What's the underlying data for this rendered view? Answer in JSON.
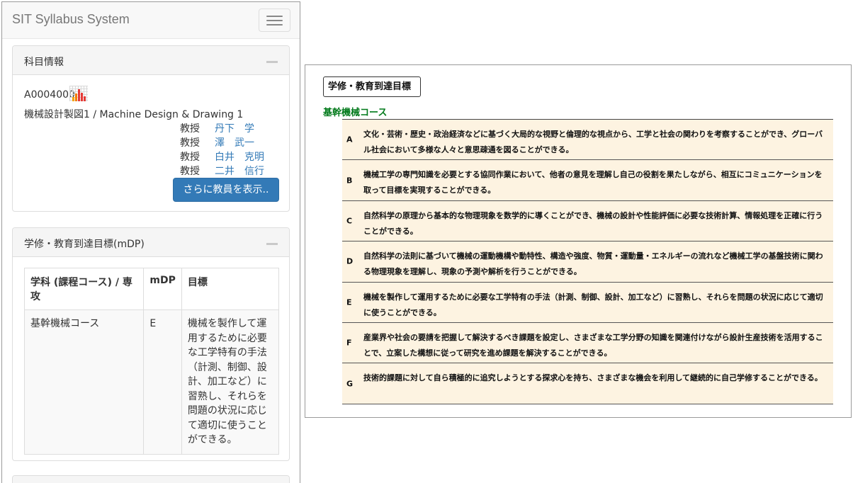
{
  "app": {
    "brand": "SIT Syllabus System"
  },
  "subject_panel": {
    "title": "科目情報",
    "code": "A0004000",
    "course_name": "機械設計製図1 / Machine Design & Drawing 1",
    "teachers": [
      {
        "role": "教授",
        "name": "丹下　学"
      },
      {
        "role": "教授",
        "name": "澤　武一"
      },
      {
        "role": "教授",
        "name": "白井　克明"
      },
      {
        "role": "教授",
        "name": "二井　信行"
      }
    ],
    "more_button": "さらに教員を表示.."
  },
  "dp_panel": {
    "title": "学修・教育到達目標(mDP)",
    "headers": [
      "学科 (課程コース) / 専攻",
      "mDP",
      "目標"
    ],
    "row": {
      "course": "基幹機械コース",
      "mdp": "E",
      "goal": "機械を製作して運用するために必要な工学特有の手法（計測、制御、設計、加工など）に習熟し、それらを問題の状況に応じて適切に使うことができる。"
    }
  },
  "document": {
    "title": "学修・教育到達目標",
    "course": "基幹機械コース",
    "goals": [
      {
        "letter": "A",
        "text": "文化・芸術・歴史・政治経済などに基づく大局的な視野と倫理的な視点から、工学と社会の関わりを考察することができ、グローバル社会において多様な人々と意思疎通を図ることができる。"
      },
      {
        "letter": "B",
        "text": "機械工学の専門知識を必要とする協同作業において、他者の意見を理解し自己の役割を果たしながら、相互にコミュニケーションを取って目標を実現することができる。"
      },
      {
        "letter": "C",
        "text": "自然科学の原理から基本的な物理現象を数学的に導くことができ、機械の設計や性能評価に必要な技術計算、情報処理を正確に行うことができる。"
      },
      {
        "letter": "D",
        "text": "自然科学の法則に基づいて機械の運動機構や動特性、構造や強度、物質・運動量・エネルギーの流れなど機械工学の基盤技術に関わる物理現象を理解し、現象の予測や解析を行うことができる。"
      },
      {
        "letter": "E",
        "text": "機械を製作して運用するために必要な工学特有の手法（計測、制御、設計、加工など）に習熟し、それらを問題の状況に応じて適切に使うことができる。"
      },
      {
        "letter": "F",
        "text": "産業界や社会の要請を把握して解決するべき課題を設定し、さまざまな工学分野の知識を関連付けながら設計生産技術を活用することで、立案した構想に従って研究を進め課題を解決することができる。"
      },
      {
        "letter": "G",
        "text": "技術的課題に対して自ら積極的に追究しようとする探求心を持ち、さまざまな機会を利用して継続的に自己学修することができる。"
      }
    ]
  },
  "colors": {
    "link": "#337ab7",
    "accent_green": "#00791a",
    "goal_bg": "#fdf3e1"
  },
  "icons": [
    "menu-icon",
    "collapse-icon",
    "chart-icon"
  ]
}
